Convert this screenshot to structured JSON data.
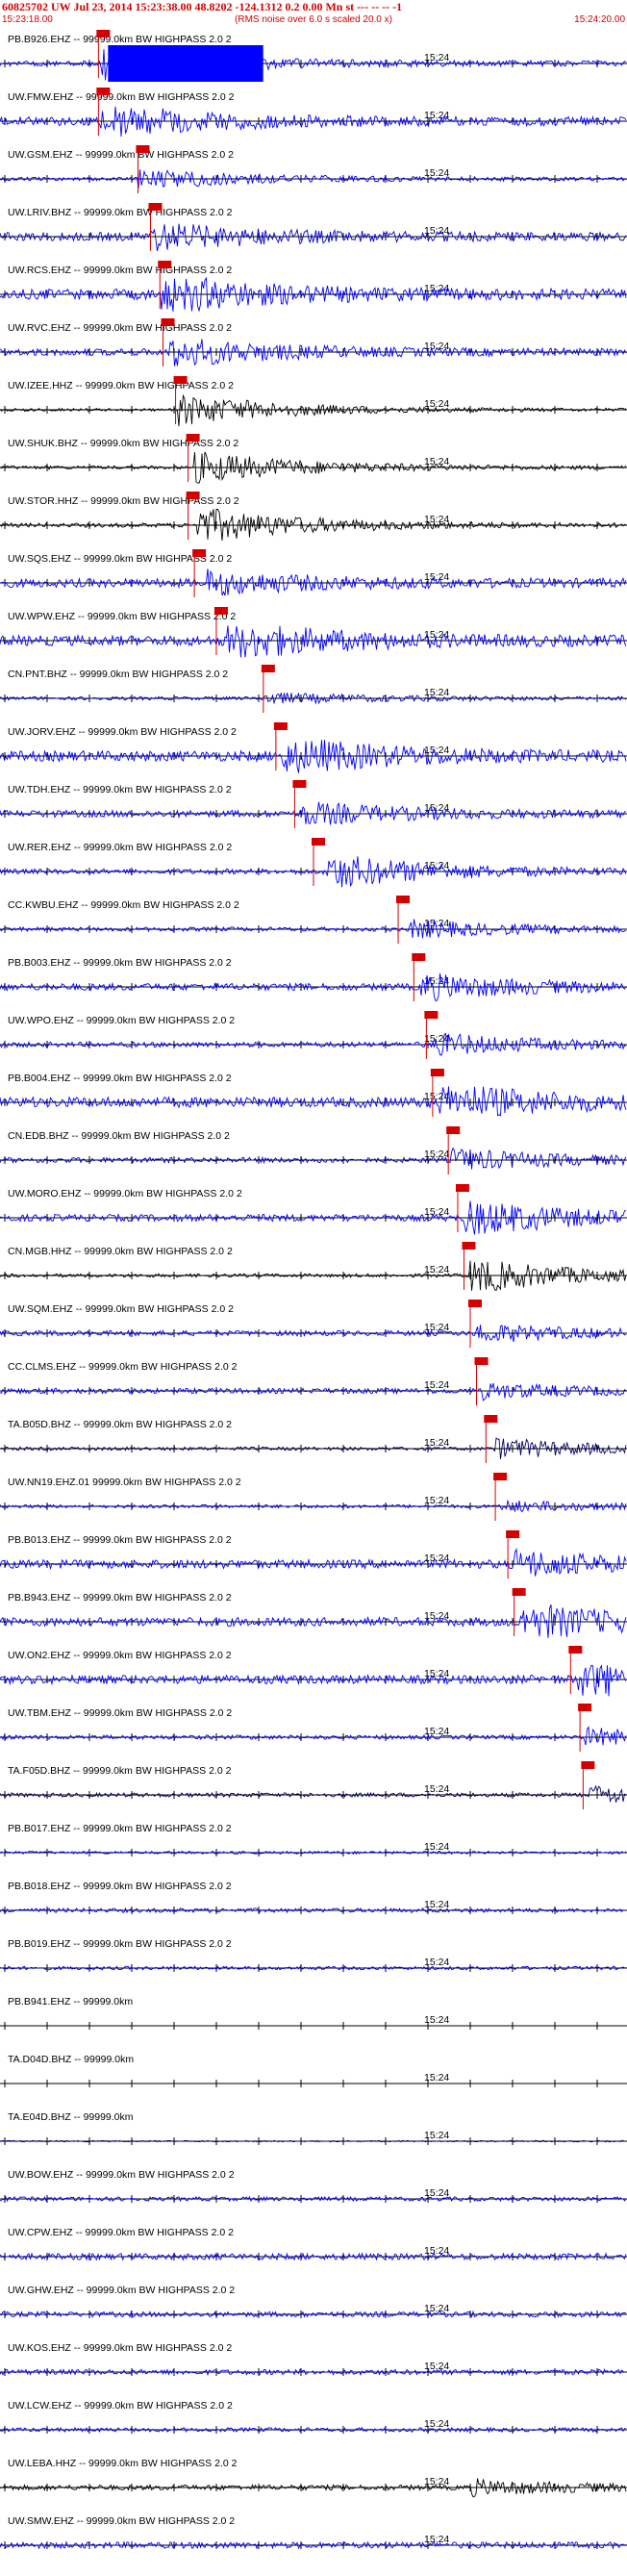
{
  "chart_data": {
    "type": "seismogram",
    "title": "60825702 UW Jul 23, 2014 15:23:38.00   48.8202 -124.1312  0.2 0.00 Mn st --- -- --  -1",
    "subtitle": "(RMS noise over 6.0 s scaled 20.0 x)",
    "start_time": "15:23:18.00",
    "end_time": "15:24:20.00",
    "tick_label": "15:24",
    "traces": [
      {
        "label": "PB.B926.EHZ -- 99999.0km BW  HIGHPASS  2.0  2",
        "color": "#0000ff",
        "amp": 0.15,
        "pick": 0.157,
        "burst": 0.16,
        "burst_amp": 1.0,
        "sat": 0.55
      },
      {
        "label": "UW.FMW.EHZ -- 99999.0km BW  HIGHPASS  2.0  2",
        "color": "#0000ff",
        "amp": 0.25,
        "pick": 0.157,
        "burst": 0.16,
        "burst_amp": 0.9
      },
      {
        "label": "UW.GSM.EHZ -- 99999.0km BW  HIGHPASS  2.0  2",
        "color": "#0000ff",
        "amp": 0.1,
        "pick": 0.22,
        "burst": 0.22,
        "burst_amp": 0.6
      },
      {
        "label": "UW.LRIV.BHZ -- 99999.0km BW  HIGHPASS  2.0  2",
        "color": "#0000cc",
        "amp": 0.25,
        "pick": 0.24,
        "burst": 0.24,
        "burst_amp": 0.7
      },
      {
        "label": "UW.RCS.EHZ -- 99999.0km BW  HIGHPASS  2.0  2",
        "color": "#0000ff",
        "amp": 0.3,
        "pick": 0.255,
        "burst": 0.255,
        "burst_amp": 1.0
      },
      {
        "label": "UW.RVC.EHZ -- 99999.0km BW  HIGHPASS  2.0  2",
        "color": "#0000ff",
        "amp": 0.2,
        "pick": 0.26,
        "burst": 0.27,
        "burst_amp": 0.8
      },
      {
        "label": "UW.IZEE.HHZ -- 99999.0km BW  HIGHPASS  2.0  2",
        "color": "#000000",
        "amp": 0.08,
        "pick": 0.28,
        "burst": 0.285,
        "burst_amp": 0.9
      },
      {
        "label": "UW.SHUK.BHZ -- 99999.0km BW  HIGHPASS  2.0  2",
        "color": "#000000",
        "amp": 0.1,
        "pick": 0.3,
        "burst": 0.31,
        "burst_amp": 0.9
      },
      {
        "label": "UW.STOR.HHZ -- 99999.0km BW  HIGHPASS  2.0  2",
        "color": "#000000",
        "amp": 0.12,
        "pick": 0.3,
        "burst": 0.315,
        "burst_amp": 1.0
      },
      {
        "label": "UW.SQS.EHZ -- 99999.0km BW  HIGHPASS  2.0  2",
        "color": "#0000ff",
        "amp": 0.25,
        "pick": 0.31,
        "burst": 0.33,
        "burst_amp": 0.6
      },
      {
        "label": "UW.WPW.EHZ -- 99999.0km BW  HIGHPASS  2.0  2",
        "color": "#0000ff",
        "amp": 0.3,
        "pick": 0.345,
        "burst": 0.36,
        "burst_amp": 1.0
      },
      {
        "label": "CN.PNT.BHZ -- 99999.0km BW  HIGHPASS  2.0  2",
        "color": "#0000cc",
        "amp": 0.1,
        "pick": 0.42,
        "burst": 0.42,
        "burst_amp": 0.3
      },
      {
        "label": "UW.JORV.EHZ -- 99999.0km BW  HIGHPASS  2.0  2",
        "color": "#0000ff",
        "amp": 0.3,
        "pick": 0.44,
        "burst": 0.45,
        "burst_amp": 1.0
      },
      {
        "label": "UW.TDH.EHZ -- 99999.0km BW  HIGHPASS  2.0  2",
        "color": "#0000ff",
        "amp": 0.2,
        "pick": 0.47,
        "burst": 0.48,
        "burst_amp": 0.6
      },
      {
        "label": "UW.RER.EHZ -- 99999.0km BW  HIGHPASS  2.0  2",
        "color": "#0000ff",
        "amp": 0.15,
        "pick": 0.5,
        "burst": 0.52,
        "burst_amp": 1.0
      },
      {
        "label": "CC.KWBU.EHZ -- 99999.0km BW  HIGHPASS  2.0  2",
        "color": "#0000ff",
        "amp": 0.12,
        "pick": 0.635,
        "burst": 0.65,
        "burst_amp": 0.5
      },
      {
        "label": "PB.B003.EHZ -- 99999.0km BW  HIGHPASS  2.0  2",
        "color": "#0000ff",
        "amp": 0.2,
        "pick": 0.66,
        "burst": 0.67,
        "burst_amp": 0.7
      },
      {
        "label": "UW.WPO.EHZ -- 99999.0km BW  HIGHPASS  2.0  2",
        "color": "#0000ff",
        "amp": 0.15,
        "pick": 0.68,
        "burst": 0.69,
        "burst_amp": 0.6
      },
      {
        "label": "PB.B004.EHZ -- 99999.0km BW  HIGHPASS  2.0  2",
        "color": "#0000ff",
        "amp": 0.3,
        "pick": 0.69,
        "burst": 0.7,
        "burst_amp": 1.0
      },
      {
        "label": "CN.EDB.BHZ -- 99999.0km BW  HIGHPASS  2.0  2",
        "color": "#0000cc",
        "amp": 0.15,
        "pick": 0.715,
        "burst": 0.72,
        "burst_amp": 0.6
      },
      {
        "label": "UW.MORO.EHZ -- 99999.0km BW  HIGHPASS  2.0  2",
        "color": "#0000ff",
        "amp": 0.2,
        "pick": 0.73,
        "burst": 0.74,
        "burst_amp": 1.0
      },
      {
        "label": "CN.MGB.HHZ -- 99999.0km BW  HIGHPASS  2.0  2",
        "color": "#000000",
        "amp": 0.1,
        "pick": 0.74,
        "burst": 0.75,
        "burst_amp": 1.0
      },
      {
        "label": "UW.SQM.EHZ -- 99999.0km BW  HIGHPASS  2.0  2",
        "color": "#0000ff",
        "amp": 0.15,
        "pick": 0.75,
        "burst": 0.76,
        "burst_amp": 0.5
      },
      {
        "label": "CC.CLMS.EHZ -- 99999.0km BW  HIGHPASS  2.0  2",
        "color": "#0000ff",
        "amp": 0.15,
        "pick": 0.76,
        "burst": 0.77,
        "burst_amp": 0.4
      },
      {
        "label": "TA.B05D.BHZ -- 99999.0km BW  HIGHPASS  2.0  2",
        "color": "#000066",
        "amp": 0.1,
        "pick": 0.775,
        "burst": 0.785,
        "burst_amp": 0.6
      },
      {
        "label": "UW.NN19.EHZ.01 99999.0km BW  HIGHPASS  2.0  2",
        "color": "#0000ff",
        "amp": 0.1,
        "pick": 0.79,
        "burst": 0.8,
        "burst_amp": 0.3
      },
      {
        "label": "PB.B013.EHZ -- 99999.0km BW  HIGHPASS  2.0  2",
        "color": "#0000ff",
        "amp": 0.25,
        "pick": 0.81,
        "burst": 0.82,
        "burst_amp": 0.7
      },
      {
        "label": "PB.B943.EHZ -- 99999.0km BW  HIGHPASS  2.0  2",
        "color": "#0000ff",
        "amp": 0.25,
        "pick": 0.82,
        "burst": 0.83,
        "burst_amp": 1.0
      },
      {
        "label": "UW.ON2.EHZ -- 99999.0km BW  HIGHPASS  2.0  2",
        "color": "#0000ff",
        "amp": 0.25,
        "pick": 0.91,
        "burst": 0.92,
        "burst_amp": 1.0
      },
      {
        "label": "UW.TBM.EHZ -- 99999.0km BW  HIGHPASS  2.0  2",
        "color": "#0000ff",
        "amp": 0.12,
        "pick": 0.925,
        "burst": 0.93,
        "burst_amp": 0.5
      },
      {
        "label": "TA.F05D.BHZ -- 99999.0km BW  HIGHPASS  2.0  2",
        "color": "#000066",
        "amp": 0.12,
        "pick": 0.93,
        "burst": 0.94,
        "burst_amp": 0.5
      },
      {
        "label": "PB.B017.EHZ -- 99999.0km BW  HIGHPASS  2.0  2",
        "color": "#0000ff",
        "amp": 0.08
      },
      {
        "label": "PB.B018.EHZ -- 99999.0km BW  HIGHPASS  2.0  2",
        "color": "#0000ff",
        "amp": 0.12
      },
      {
        "label": "PB.B019.EHZ -- 99999.0km BW  HIGHPASS  2.0  2",
        "color": "#0000ff",
        "amp": 0.1
      },
      {
        "label": "PB.B941.EHZ -- 99999.0km",
        "color": "#0000ff",
        "amp": 0.0
      },
      {
        "label": "TA.D04D.BHZ -- 99999.0km",
        "color": "#000066",
        "amp": 0.0
      },
      {
        "label": "TA.E04D.BHZ -- 99999.0km",
        "color": "#000066",
        "amp": 0.04
      },
      {
        "label": "UW.BOW.EHZ -- 99999.0km BW  HIGHPASS  2.0  2",
        "color": "#0000ff",
        "amp": 0.12
      },
      {
        "label": "UW.CPW.EHZ -- 99999.0km BW  HIGHPASS  2.0  2",
        "color": "#0000ff",
        "amp": 0.18
      },
      {
        "label": "UW.GHW.EHZ -- 99999.0km BW  HIGHPASS  2.0  2",
        "color": "#0000ff",
        "amp": 0.15
      },
      {
        "label": "UW.KOS.EHZ -- 99999.0km BW  HIGHPASS  2.0  2",
        "color": "#0000ff",
        "amp": 0.15
      },
      {
        "label": "UW.LCW.EHZ -- 99999.0km BW  HIGHPASS  2.0  2",
        "color": "#0000ff",
        "amp": 0.12
      },
      {
        "label": "UW.LEBA.HHZ -- 99999.0km BW  HIGHPASS  2.0  2",
        "color": "#000000",
        "amp": 0.15,
        "burst": 0.75,
        "burst_amp": 0.4
      },
      {
        "label": "UW.SMW.EHZ -- 99999.0km BW  HIGHPASS  2.0  2",
        "color": "#0000ff",
        "amp": 0.18
      }
    ]
  }
}
